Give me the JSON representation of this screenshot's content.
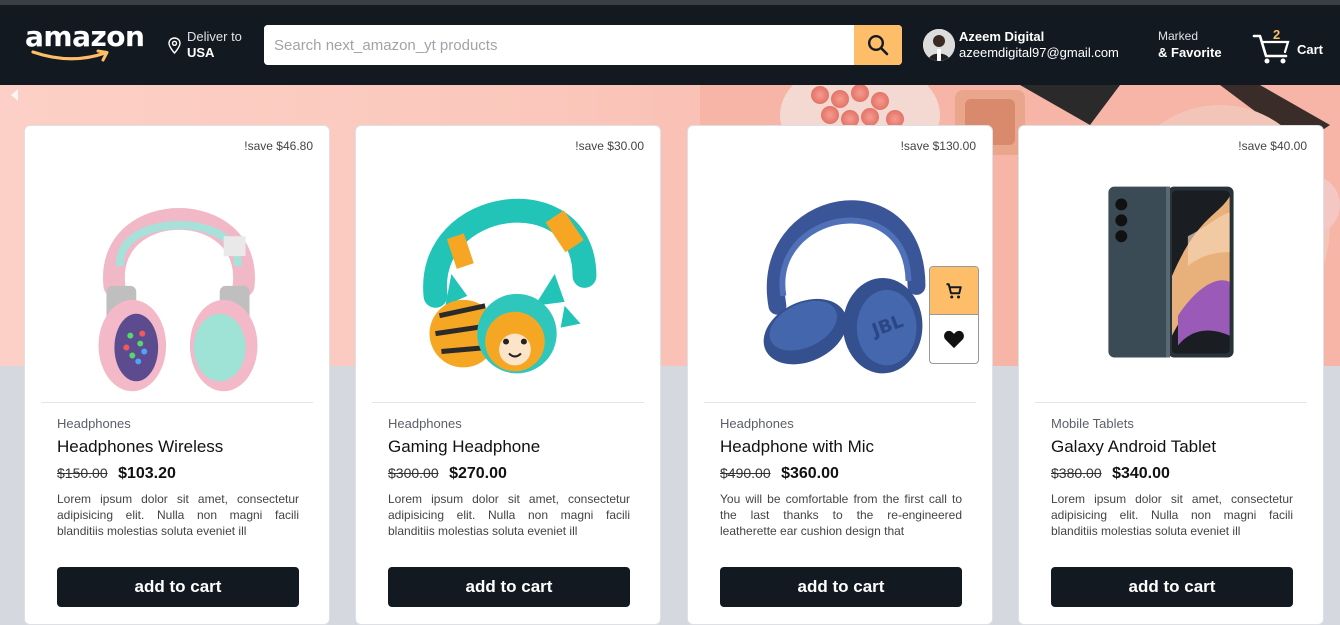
{
  "header": {
    "logo_text": "amazon",
    "deliver_label": "Deliver to",
    "deliver_location": "USA",
    "search_placeholder": "Search next_amazon_yt products",
    "user_name": "Azeem Digital",
    "user_email": "azeemdigital97@gmail.com",
    "marked_label": "Marked",
    "favorite_label": "& Favorite",
    "cart_count": "2",
    "cart_label": "Cart"
  },
  "colors": {
    "header_bg": "#131921",
    "accent": "#febd69",
    "button_bg": "#131921",
    "page_bg": "#d5d8de"
  },
  "products": [
    {
      "save": "!save $46.80",
      "category": "Headphones",
      "title": "Headphones Wireless",
      "old_price": "$150.00",
      "price": "$103.20",
      "description": "Lorem ipsum dolor sit amet, consectetur adipisicing elit. Nulla non magni facili blanditiis molestias soluta eveniet ill",
      "button": "add to cart"
    },
    {
      "save": "!save $30.00",
      "category": "Headphones",
      "title": "Gaming Headphone",
      "old_price": "$300.00",
      "price": "$270.00",
      "description": "Lorem ipsum dolor sit amet, consectetur adipisicing elit. Nulla non magni facili blanditiis molestias soluta eveniet ill",
      "button": "add to cart"
    },
    {
      "save": "!save $130.00",
      "category": "Headphones",
      "title": "Headphone with Mic",
      "old_price": "$490.00",
      "price": "$360.00",
      "description": "You will be comfortable from the first call to the last thanks to the re-engineered leatherette ear cushion design that",
      "button": "add to cart"
    },
    {
      "save": "!save $40.00",
      "category": "Mobile Tablets",
      "title": "Galaxy Android Tablet",
      "old_price": "$380.00",
      "price": "$340.00",
      "description": "Lorem ipsum dolor sit amet, consectetur adipisicing elit. Nulla non magni facili blanditiis molestias soluta eveniet ill",
      "button": "add to cart"
    }
  ],
  "icons": {
    "search": "search-icon",
    "location": "location-pin-icon",
    "cart": "cart-icon",
    "heart": "heart-icon",
    "banner_prev": "chevron-left-icon"
  }
}
